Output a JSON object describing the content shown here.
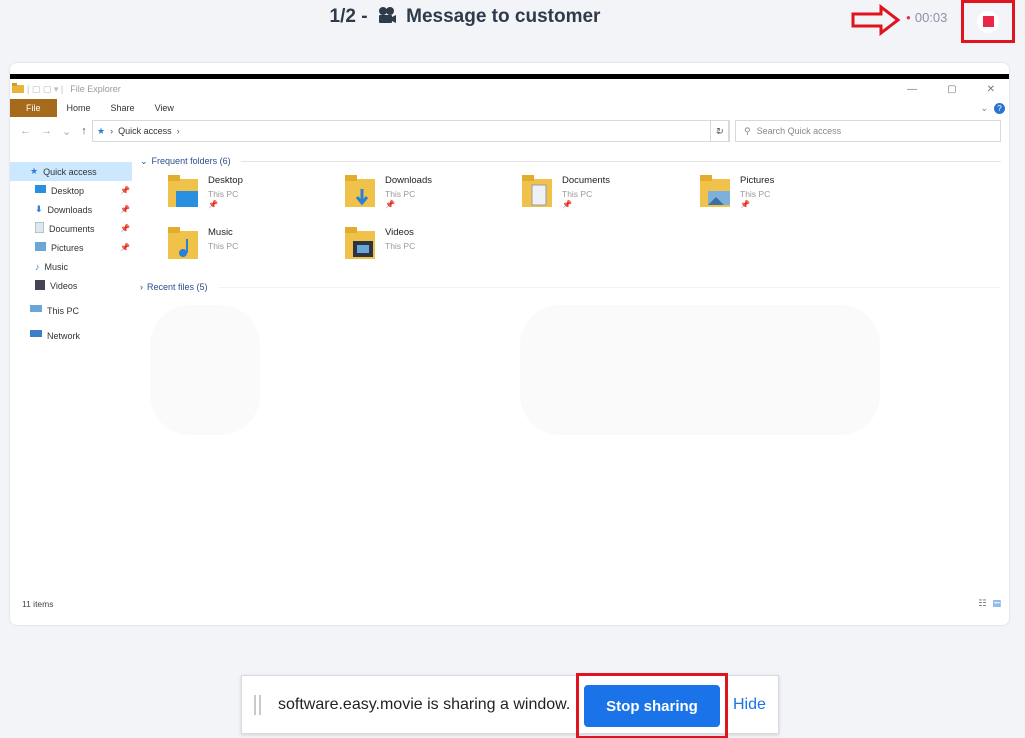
{
  "header": {
    "title": "1/2 - 🎥 Message to customer",
    "title_prefix": "1/2 -",
    "title_text": "Message to customer",
    "timer": "00:03",
    "icons": [
      "camera-icon",
      "arrow-right-icon",
      "stop-icon"
    ]
  },
  "explorer": {
    "window_title": "File Explorer",
    "ribbon_tabs": [
      "File",
      "Home",
      "Share",
      "View"
    ],
    "breadcrumb": "Quick access",
    "search_placeholder": "Search Quick access",
    "sidebar": [
      {
        "label": "Quick access",
        "icon": "star-icon"
      },
      {
        "label": "Desktop",
        "icon": "desktop-icon"
      },
      {
        "label": "Downloads",
        "icon": "download-icon"
      },
      {
        "label": "Documents",
        "icon": "documents-icon"
      },
      {
        "label": "Pictures",
        "icon": "pictures-icon"
      },
      {
        "label": "Music",
        "icon": "music-icon"
      },
      {
        "label": "Videos",
        "icon": "videos-icon"
      },
      {
        "label": "This PC",
        "icon": "pc-icon"
      },
      {
        "label": "Network",
        "icon": "network-icon"
      }
    ],
    "frequent_header": "Frequent folders (6)",
    "folders": [
      {
        "name": "Desktop",
        "sub": "This PC"
      },
      {
        "name": "Downloads",
        "sub": "This PC"
      },
      {
        "name": "Documents",
        "sub": "This PC"
      },
      {
        "name": "Pictures",
        "sub": "This PC"
      },
      {
        "name": "Music",
        "sub": "This PC"
      },
      {
        "name": "Videos",
        "sub": "This PC"
      }
    ],
    "recent_header": "Recent files (5)",
    "status": "11 items"
  },
  "sharebar": {
    "message": "software.easy.movie is sharing a window.",
    "stop_label": "Stop sharing",
    "hide_label": "Hide"
  },
  "colors": {
    "accent": "#1a73e8",
    "highlight": "#e0141e",
    "file_tab": "#a56a1b"
  }
}
